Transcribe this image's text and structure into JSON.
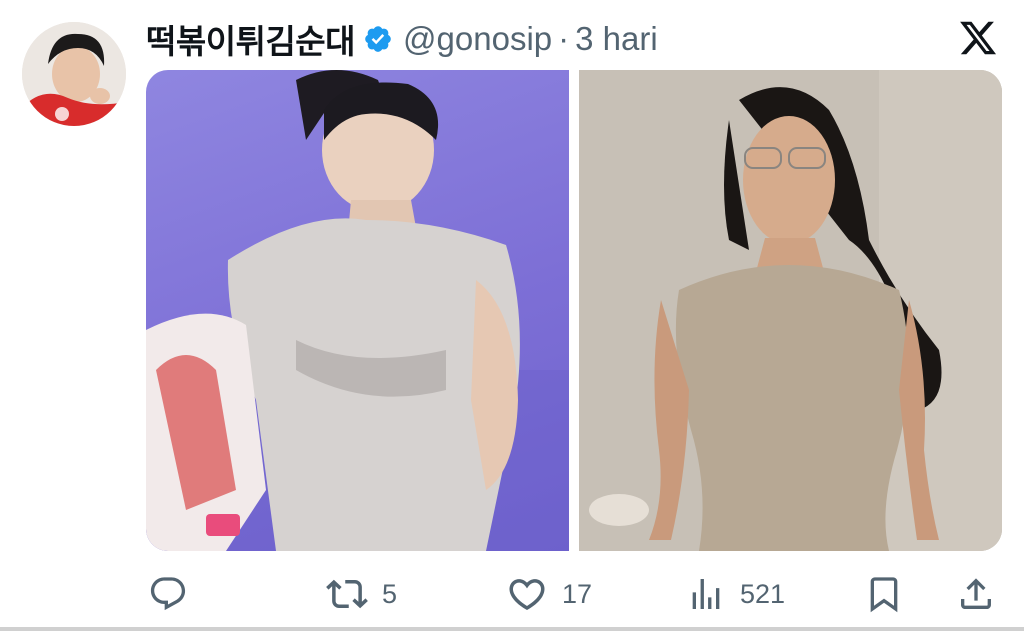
{
  "tweet": {
    "display_name": "떡볶이튀김순대",
    "handle": "@gonosip",
    "separator": "·",
    "time": "3 hari",
    "verified": true
  },
  "actions": {
    "reply_icon": "reply-icon",
    "retweet_count": "5",
    "like_count": "17",
    "view_count": "521"
  },
  "colors": {
    "text": "#0f1419",
    "secondary": "#536471",
    "verified_badge": "#1d9bf0"
  }
}
